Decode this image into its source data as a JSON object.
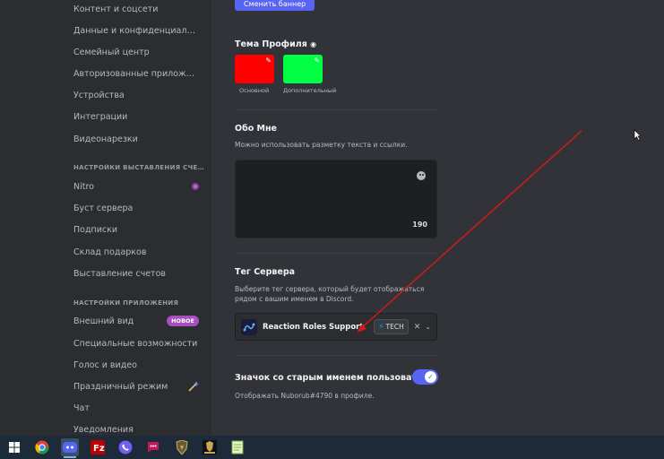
{
  "sidebar": {
    "items_top": [
      {
        "label": "Контент и соцсети"
      },
      {
        "label": "Данные и конфиденциально..."
      },
      {
        "label": "Семейный центр"
      },
      {
        "label": "Авторизованные приложения"
      },
      {
        "label": "Устройства"
      },
      {
        "label": "Интеграции"
      },
      {
        "label": "Видеонарезки"
      }
    ],
    "billing_header": "НАСТРОЙКИ ВЫСТАВЛЕНИЯ СЧЕТ...",
    "billing_items": [
      {
        "label": "Nitro"
      },
      {
        "label": "Буст сервера"
      },
      {
        "label": "Подписки"
      },
      {
        "label": "Склад подарков"
      },
      {
        "label": "Выставление счетов"
      }
    ],
    "app_header": "НАСТРОЙКИ ПРИЛОЖЕНИЯ",
    "app_items": [
      {
        "label": "Внешний вид",
        "badge": "НОВОЕ"
      },
      {
        "label": "Специальные возможности"
      },
      {
        "label": "Голос и видео"
      },
      {
        "label": "Праздничный режим"
      },
      {
        "label": "Чат"
      },
      {
        "label": "Уведомления"
      }
    ]
  },
  "profile": {
    "change_banner_button": "Сменить баннер",
    "theme": {
      "title": "Тема Профиля",
      "primary": {
        "label": "Основной",
        "color": "#ff0000"
      },
      "secondary": {
        "label": "Дополнительный",
        "color": "#00ff44"
      }
    },
    "about": {
      "title": "Обо Мне",
      "description": "Можно использовать разметку текста и ссылки.",
      "value": "",
      "char_count": "190"
    },
    "server_tag": {
      "title": "Тег Сервера",
      "description_line1": "Выберите тег сервера, который будет отображаться",
      "description_line2": "рядом с вашим именем в Discord.",
      "selected_server": "Reaction Roles Support",
      "tag_text": "TECH"
    },
    "legacy_username": {
      "title": "Значок со старым именем пользователя",
      "description": "Отображать Nuborub#4790 в профиле.",
      "enabled": true
    }
  },
  "colors": {
    "accent": "#5865f2",
    "annotation_arrow": "#d11a1a"
  },
  "taskbar": {
    "icons": [
      "windows-start-icon",
      "chrome-icon",
      "discord-icon",
      "filezilla-icon",
      "viber-icon",
      "chat-app-icon",
      "game-icon-1",
      "game-icon-2",
      "notepad-icon"
    ]
  }
}
